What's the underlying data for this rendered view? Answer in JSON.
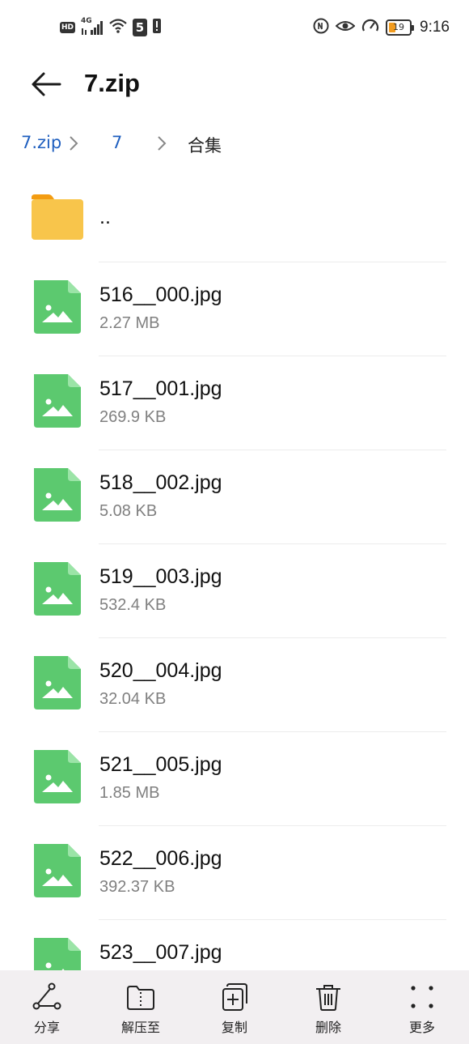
{
  "status_bar": {
    "hd": "HD",
    "network": "4G",
    "sim": "5",
    "battery_level": "19",
    "time": "9:16",
    "icons": [
      "hd-icon",
      "signal-icon",
      "wifi-icon",
      "sim-icon",
      "alert-icon",
      "nfc-icon",
      "eye-icon",
      "speed-icon",
      "battery-icon"
    ]
  },
  "header": {
    "title": "7.zip",
    "back_icon": "back-arrow-icon"
  },
  "breadcrumb": {
    "items": [
      "7.zip",
      "7",
      "合集"
    ]
  },
  "files": [
    {
      "name": "..",
      "size": "",
      "type": "folder"
    },
    {
      "name": "516__000.jpg",
      "size": "2.27 MB",
      "type": "image"
    },
    {
      "name": "517__001.jpg",
      "size": "269.9 KB",
      "type": "image"
    },
    {
      "name": "518__002.jpg",
      "size": "5.08 KB",
      "type": "image"
    },
    {
      "name": "519__003.jpg",
      "size": "532.4 KB",
      "type": "image"
    },
    {
      "name": "520__004.jpg",
      "size": "32.04 KB",
      "type": "image"
    },
    {
      "name": "521__005.jpg",
      "size": "1.85 MB",
      "type": "image"
    },
    {
      "name": "522__006.jpg",
      "size": "392.37 KB",
      "type": "image"
    },
    {
      "name": "523__007.jpg",
      "size": "",
      "type": "image"
    }
  ],
  "toolbar": {
    "share": "分享",
    "extract": "解压至",
    "copy": "复制",
    "delete": "删除",
    "more": "更多"
  },
  "colors": {
    "accent": "#1f5fbf",
    "image_icon": "#5cc96f",
    "folder_icon": "#f8c54b",
    "toolbar_bg": "#f2eff1"
  }
}
